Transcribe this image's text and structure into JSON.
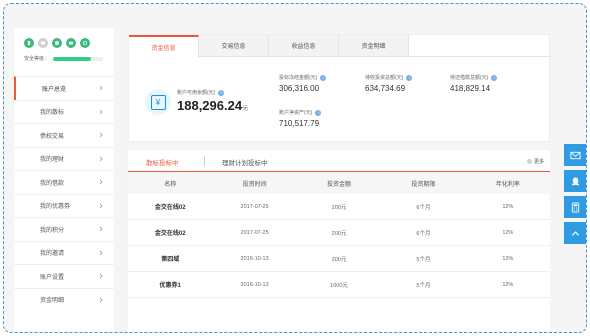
{
  "sidebar": {
    "security_label": "安全等级：",
    "security_level": 0.75,
    "security_icons": [
      "phone-icon",
      "mail-icon",
      "id-card-icon",
      "bank-card-icon",
      "shield-icon"
    ],
    "items": [
      {
        "label": "账户总览",
        "active": true
      },
      {
        "label": "我的散标"
      },
      {
        "label": "债权交易"
      },
      {
        "label": "我的理财"
      },
      {
        "label": "我的借款"
      },
      {
        "label": "我的优惠券"
      },
      {
        "label": "我的积分"
      },
      {
        "label": "我的邀请"
      },
      {
        "label": "账户设置"
      },
      {
        "label": "资金明细"
      }
    ]
  },
  "tabs": [
    "资金信息",
    "交易信息",
    "收益信息",
    "资金明细"
  ],
  "balance": {
    "label": "账户可用余额(元)",
    "value": "188,296.24",
    "unit": "元"
  },
  "stats": {
    "frozen": {
      "label": "投标冻结金额(元)",
      "value": "306,316.00"
    },
    "pending_income": {
      "label": "待收投资总额(元)",
      "value": "634,734.69"
    },
    "pending_repay": {
      "label": "待还借款总额(元)",
      "value": "418,829.14"
    },
    "net_assets": {
      "label": "账户净资产(元)",
      "value": "710,517.79"
    }
  },
  "records": {
    "sub_tabs": [
      "散标投标中",
      "理财计划投标中"
    ],
    "more": "更多",
    "columns": [
      "名称",
      "投资时间",
      "投资金额",
      "投资期限",
      "年化利率"
    ],
    "rows": [
      [
        "金交在线02",
        "2017-07-25",
        "200元",
        "6个月",
        "12%"
      ],
      [
        "金交在线02",
        "2017-07-25",
        "200元",
        "6个月",
        "12%"
      ],
      [
        "第四域",
        "2016-10-13",
        "200元",
        "5个月",
        "12%"
      ],
      [
        "优惠券1",
        "2016-10-13",
        "1000元",
        "5个月",
        "12%"
      ]
    ]
  },
  "float_buttons": [
    "mail-icon",
    "qq-icon",
    "calculator-icon",
    "arrow-up-icon"
  ],
  "colors": {
    "accent": "#e85a3c",
    "float": "#2f9be3",
    "progress": "#2fcf85"
  }
}
